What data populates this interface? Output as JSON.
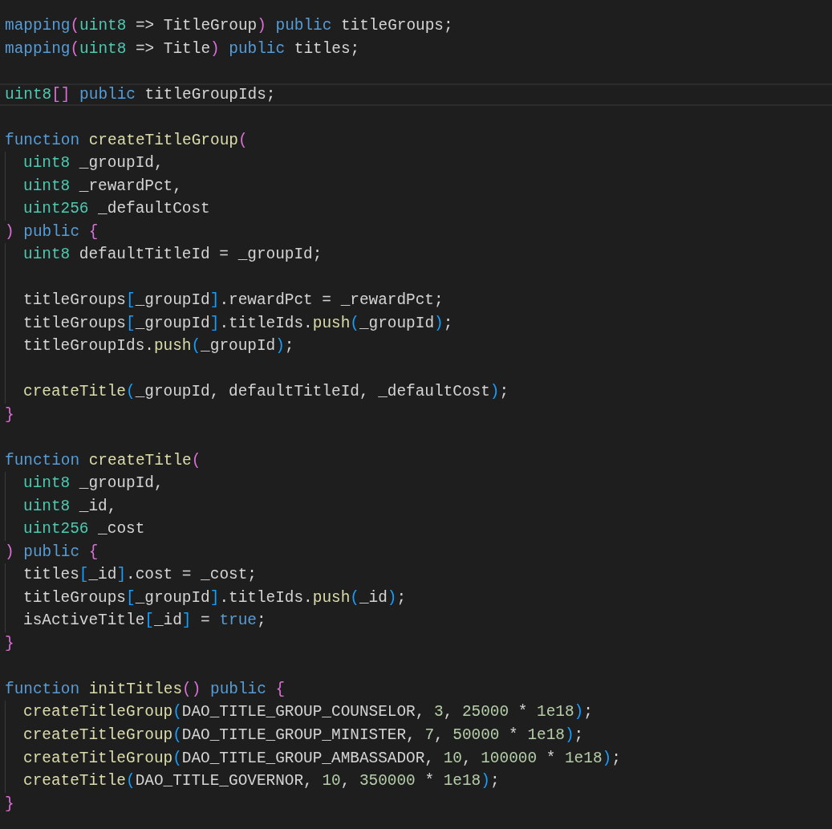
{
  "editor": {
    "lines": [
      {
        "kind": "code",
        "current": false,
        "indented": false,
        "tokens": [
          {
            "kind": "kw",
            "text": "mapping"
          },
          {
            "kind": "b1",
            "text": "("
          },
          {
            "kind": "type",
            "text": "uint8"
          },
          {
            "kind": "plain",
            "text": " => TitleGroup"
          },
          {
            "kind": "b1",
            "text": ")"
          },
          {
            "kind": "kw",
            "text": " public"
          },
          {
            "kind": "plain",
            "text": " titleGroups;"
          }
        ]
      },
      {
        "kind": "code",
        "current": false,
        "indented": false,
        "tokens": [
          {
            "kind": "kw",
            "text": "mapping"
          },
          {
            "kind": "b1",
            "text": "("
          },
          {
            "kind": "type",
            "text": "uint8"
          },
          {
            "kind": "plain",
            "text": " => Title"
          },
          {
            "kind": "b1",
            "text": ")"
          },
          {
            "kind": "kw",
            "text": " public"
          },
          {
            "kind": "plain",
            "text": " titles;"
          }
        ]
      },
      {
        "kind": "blank",
        "current": false,
        "indented": false
      },
      {
        "kind": "code",
        "current": true,
        "indented": false,
        "tokens": [
          {
            "kind": "type",
            "text": "uint8"
          },
          {
            "kind": "b1",
            "text": "[]"
          },
          {
            "kind": "kw",
            "text": " public"
          },
          {
            "kind": "plain",
            "text": " titleGroupIds;"
          }
        ]
      },
      {
        "kind": "blank",
        "current": false,
        "indented": false
      },
      {
        "kind": "code",
        "current": false,
        "indented": false,
        "tokens": [
          {
            "kind": "kw",
            "text": "function"
          },
          {
            "kind": "fn",
            "text": " createTitleGroup"
          },
          {
            "kind": "b1",
            "text": "("
          }
        ]
      },
      {
        "kind": "code",
        "current": false,
        "indented": true,
        "tokens": [
          {
            "kind": "type",
            "text": "uint8"
          },
          {
            "kind": "plain",
            "text": " _groupId,"
          }
        ]
      },
      {
        "kind": "code",
        "current": false,
        "indented": true,
        "tokens": [
          {
            "kind": "type",
            "text": "uint8"
          },
          {
            "kind": "plain",
            "text": " _rewardPct,"
          }
        ]
      },
      {
        "kind": "code",
        "current": false,
        "indented": true,
        "tokens": [
          {
            "kind": "type",
            "text": "uint256"
          },
          {
            "kind": "plain",
            "text": " _defaultCost"
          }
        ]
      },
      {
        "kind": "code",
        "current": false,
        "indented": false,
        "tokens": [
          {
            "kind": "b1",
            "text": ")"
          },
          {
            "kind": "kw",
            "text": " public"
          },
          {
            "kind": "b1",
            "text": " {"
          }
        ]
      },
      {
        "kind": "code",
        "current": false,
        "indented": true,
        "tokens": [
          {
            "kind": "type",
            "text": "uint8"
          },
          {
            "kind": "plain",
            "text": " defaultTitleId = _groupId;"
          }
        ]
      },
      {
        "kind": "blank",
        "current": false,
        "indented": true
      },
      {
        "kind": "code",
        "current": false,
        "indented": true,
        "tokens": [
          {
            "kind": "plain",
            "text": "titleGroups"
          },
          {
            "kind": "b2",
            "text": "["
          },
          {
            "kind": "plain",
            "text": "_groupId"
          },
          {
            "kind": "b2",
            "text": "]"
          },
          {
            "kind": "plain",
            "text": ".rewardPct = _rewardPct;"
          }
        ]
      },
      {
        "kind": "code",
        "current": false,
        "indented": true,
        "tokens": [
          {
            "kind": "plain",
            "text": "titleGroups"
          },
          {
            "kind": "b2",
            "text": "["
          },
          {
            "kind": "plain",
            "text": "_groupId"
          },
          {
            "kind": "b2",
            "text": "]"
          },
          {
            "kind": "plain",
            "text": ".titleIds."
          },
          {
            "kind": "fn",
            "text": "push"
          },
          {
            "kind": "b2",
            "text": "("
          },
          {
            "kind": "plain",
            "text": "_groupId"
          },
          {
            "kind": "b2",
            "text": ")"
          },
          {
            "kind": "plain",
            "text": ";"
          }
        ]
      },
      {
        "kind": "code",
        "current": false,
        "indented": true,
        "tokens": [
          {
            "kind": "plain",
            "text": "titleGroupIds."
          },
          {
            "kind": "fn",
            "text": "push"
          },
          {
            "kind": "b2",
            "text": "("
          },
          {
            "kind": "plain",
            "text": "_groupId"
          },
          {
            "kind": "b2",
            "text": ")"
          },
          {
            "kind": "plain",
            "text": ";"
          }
        ]
      },
      {
        "kind": "blank",
        "current": false,
        "indented": true
      },
      {
        "kind": "code",
        "current": false,
        "indented": true,
        "tokens": [
          {
            "kind": "fn",
            "text": "createTitle"
          },
          {
            "kind": "b2",
            "text": "("
          },
          {
            "kind": "plain",
            "text": "_groupId, defaultTitleId, _defaultCost"
          },
          {
            "kind": "b2",
            "text": ")"
          },
          {
            "kind": "plain",
            "text": ";"
          }
        ]
      },
      {
        "kind": "code",
        "current": false,
        "indented": false,
        "tokens": [
          {
            "kind": "b1",
            "text": "}"
          }
        ]
      },
      {
        "kind": "blank",
        "current": false,
        "indented": false
      },
      {
        "kind": "code",
        "current": false,
        "indented": false,
        "tokens": [
          {
            "kind": "kw",
            "text": "function"
          },
          {
            "kind": "fn",
            "text": " createTitle"
          },
          {
            "kind": "b1",
            "text": "("
          }
        ]
      },
      {
        "kind": "code",
        "current": false,
        "indented": true,
        "tokens": [
          {
            "kind": "type",
            "text": "uint8"
          },
          {
            "kind": "plain",
            "text": " _groupId,"
          }
        ]
      },
      {
        "kind": "code",
        "current": false,
        "indented": true,
        "tokens": [
          {
            "kind": "type",
            "text": "uint8"
          },
          {
            "kind": "plain",
            "text": " _id,"
          }
        ]
      },
      {
        "kind": "code",
        "current": false,
        "indented": true,
        "tokens": [
          {
            "kind": "type",
            "text": "uint256"
          },
          {
            "kind": "plain",
            "text": " _cost"
          }
        ]
      },
      {
        "kind": "code",
        "current": false,
        "indented": false,
        "tokens": [
          {
            "kind": "b1",
            "text": ")"
          },
          {
            "kind": "kw",
            "text": " public"
          },
          {
            "kind": "b1",
            "text": " {"
          }
        ]
      },
      {
        "kind": "code",
        "current": false,
        "indented": true,
        "tokens": [
          {
            "kind": "plain",
            "text": "titles"
          },
          {
            "kind": "b2",
            "text": "["
          },
          {
            "kind": "plain",
            "text": "_id"
          },
          {
            "kind": "b2",
            "text": "]"
          },
          {
            "kind": "plain",
            "text": ".cost = _cost;"
          }
        ]
      },
      {
        "kind": "code",
        "current": false,
        "indented": true,
        "tokens": [
          {
            "kind": "plain",
            "text": "titleGroups"
          },
          {
            "kind": "b2",
            "text": "["
          },
          {
            "kind": "plain",
            "text": "_groupId"
          },
          {
            "kind": "b2",
            "text": "]"
          },
          {
            "kind": "plain",
            "text": ".titleIds."
          },
          {
            "kind": "fn",
            "text": "push"
          },
          {
            "kind": "b2",
            "text": "("
          },
          {
            "kind": "plain",
            "text": "_id"
          },
          {
            "kind": "b2",
            "text": ")"
          },
          {
            "kind": "plain",
            "text": ";"
          }
        ]
      },
      {
        "kind": "code",
        "current": false,
        "indented": true,
        "tokens": [
          {
            "kind": "plain",
            "text": "isActiveTitle"
          },
          {
            "kind": "b2",
            "text": "["
          },
          {
            "kind": "plain",
            "text": "_id"
          },
          {
            "kind": "b2",
            "text": "]"
          },
          {
            "kind": "plain",
            "text": " ="
          },
          {
            "kind": "kw",
            "text": " true"
          },
          {
            "kind": "plain",
            "text": ";"
          }
        ]
      },
      {
        "kind": "code",
        "current": false,
        "indented": false,
        "tokens": [
          {
            "kind": "b1",
            "text": "}"
          }
        ]
      },
      {
        "kind": "blank",
        "current": false,
        "indented": false
      },
      {
        "kind": "code",
        "current": false,
        "indented": false,
        "tokens": [
          {
            "kind": "kw",
            "text": "function"
          },
          {
            "kind": "fn",
            "text": " initTitles"
          },
          {
            "kind": "b1",
            "text": "()"
          },
          {
            "kind": "kw",
            "text": " public"
          },
          {
            "kind": "b1",
            "text": " {"
          }
        ]
      },
      {
        "kind": "code",
        "current": false,
        "indented": true,
        "tokens": [
          {
            "kind": "fn",
            "text": "createTitleGroup"
          },
          {
            "kind": "b2",
            "text": "("
          },
          {
            "kind": "plain",
            "text": "DAO_TITLE_GROUP_COUNSELOR, "
          },
          {
            "kind": "num",
            "text": "3"
          },
          {
            "kind": "plain",
            "text": ", "
          },
          {
            "kind": "num",
            "text": "25000"
          },
          {
            "kind": "plain",
            "text": " * "
          },
          {
            "kind": "num",
            "text": "1e18"
          },
          {
            "kind": "b2",
            "text": ")"
          },
          {
            "kind": "plain",
            "text": ";"
          }
        ]
      },
      {
        "kind": "code",
        "current": false,
        "indented": true,
        "tokens": [
          {
            "kind": "fn",
            "text": "createTitleGroup"
          },
          {
            "kind": "b2",
            "text": "("
          },
          {
            "kind": "plain",
            "text": "DAO_TITLE_GROUP_MINISTER, "
          },
          {
            "kind": "num",
            "text": "7"
          },
          {
            "kind": "plain",
            "text": ", "
          },
          {
            "kind": "num",
            "text": "50000"
          },
          {
            "kind": "plain",
            "text": " * "
          },
          {
            "kind": "num",
            "text": "1e18"
          },
          {
            "kind": "b2",
            "text": ")"
          },
          {
            "kind": "plain",
            "text": ";"
          }
        ]
      },
      {
        "kind": "code",
        "current": false,
        "indented": true,
        "tokens": [
          {
            "kind": "fn",
            "text": "createTitleGroup"
          },
          {
            "kind": "b2",
            "text": "("
          },
          {
            "kind": "plain",
            "text": "DAO_TITLE_GROUP_AMBASSADOR, "
          },
          {
            "kind": "num",
            "text": "10"
          },
          {
            "kind": "plain",
            "text": ", "
          },
          {
            "kind": "num",
            "text": "100000"
          },
          {
            "kind": "plain",
            "text": " * "
          },
          {
            "kind": "num",
            "text": "1e18"
          },
          {
            "kind": "b2",
            "text": ")"
          },
          {
            "kind": "plain",
            "text": ";"
          }
        ]
      },
      {
        "kind": "code",
        "current": false,
        "indented": true,
        "tokens": [
          {
            "kind": "fn",
            "text": "createTitle"
          },
          {
            "kind": "b2",
            "text": "("
          },
          {
            "kind": "plain",
            "text": "DAO_TITLE_GOVERNOR, "
          },
          {
            "kind": "num",
            "text": "10"
          },
          {
            "kind": "plain",
            "text": ", "
          },
          {
            "kind": "num",
            "text": "350000"
          },
          {
            "kind": "plain",
            "text": " * "
          },
          {
            "kind": "num",
            "text": "1e18"
          },
          {
            "kind": "b2",
            "text": ")"
          },
          {
            "kind": "plain",
            "text": ";"
          }
        ]
      },
      {
        "kind": "code",
        "current": false,
        "indented": false,
        "tokens": [
          {
            "kind": "b1",
            "text": "}"
          }
        ]
      }
    ]
  }
}
